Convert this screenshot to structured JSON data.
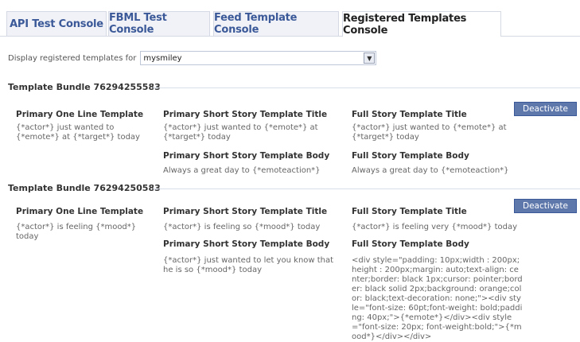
{
  "tabs": [
    {
      "label": "API Test Console"
    },
    {
      "label": "FBML Test Console"
    },
    {
      "label": "Feed Template Console"
    },
    {
      "label": "Registered Templates Console"
    }
  ],
  "active_tab_index": 3,
  "display": {
    "label": "Display registered templates for",
    "selected": "mysmiley"
  },
  "bundles": [
    {
      "title": "Template Bundle 76294255583",
      "one_line_head": "Primary One Line Template",
      "one_line_text": "{*actor*} just wanted to {*emote*} at {*target*} today",
      "short_title_head": "Primary Short Story Template Title",
      "short_title_text": "{*actor*} just wanted to {*emote*} at {*target*} today",
      "short_body_head": "Primary Short Story Template Body",
      "short_body_text": "Always a great day to {*emoteaction*}",
      "full_title_head": "Full Story Template Title",
      "full_title_text": "{*actor*} just wanted to {*emote*} at {*target*} today",
      "full_body_head": "Full Story Template Body",
      "full_body_text": "Always a great day to {*emoteaction*}",
      "button": "Deactivate"
    },
    {
      "title": "Template Bundle 76294250583",
      "one_line_head": "Primary One Line Template",
      "one_line_text": "{*actor*} is feeling {*mood*} today",
      "short_title_head": "Primary Short Story Template Title",
      "short_title_text": "{*actor*} is feeling so {*mood*} today",
      "short_body_head": "Primary Short Story Template Body",
      "short_body_text": "{*actor*} just wanted to let you know that he is so {*mood*} today",
      "full_title_head": "Full Story Template Title",
      "full_title_text": "{*actor*} is feeling very {*mood*} today",
      "full_body_head": "Full Story Template Body",
      "full_body_text": "<div style=\"padding: 10px;width : 200px;height : 200px;margin: auto;text-align: center;border: black 1px;cursor: pointer;border: black solid 2px;background: orange;color: black;text-decoration: none;\"><div style=\"font-size: 60pt;font-weight: bold;padding: 40px;\">{*emote*}</div><div style=\"font-size: 20px; font-weight:bold;\">{*mood*}</div></div>",
      "button": "Deactivate"
    }
  ],
  "icons": {
    "select_arrow": "chevron-down-icon"
  },
  "colors": {
    "link_blue": "#3b5998",
    "button_bg": "#5f78ab",
    "tab_bg": "#f0f2f7"
  }
}
